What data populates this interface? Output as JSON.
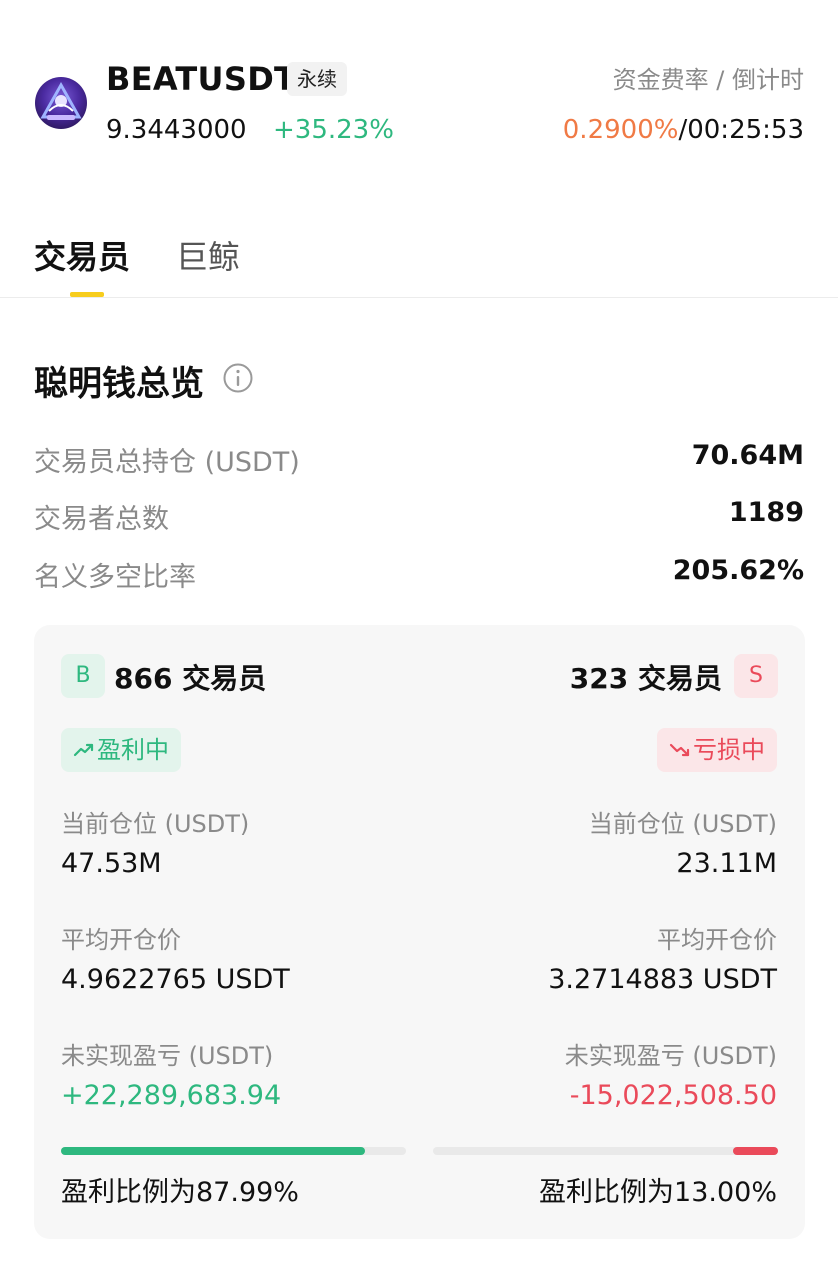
{
  "header": {
    "symbol": "BEATUSDT",
    "contract_tag": "永续",
    "price": "9.3443000",
    "change": "+35.23%",
    "funding_label": "资金费率 / 倒计时",
    "funding_rate": "0.2900%",
    "separator": "/",
    "countdown": "00:25:53"
  },
  "tabs": [
    {
      "label": "交易员",
      "active": true
    },
    {
      "label": "巨鲸",
      "active": false
    }
  ],
  "overview": {
    "title": "聪明钱总览",
    "stats": [
      {
        "label": "交易员总持仓 (USDT)",
        "value": "70.64M"
      },
      {
        "label": "交易者总数",
        "value": "1189"
      },
      {
        "label": "名义多空比率",
        "value": "205.62%"
      }
    ]
  },
  "long_side": {
    "badge": "B",
    "count_label": "866 交易员",
    "status": "盈利中",
    "position_label": "当前仓位 (USDT)",
    "position_value": "47.53M",
    "avg_price_label": "平均开仓价",
    "avg_price_value": "4.9622765 USDT",
    "upnl_label": "未实现盈亏 (USDT)",
    "upnl_value": "+22,289,683.94",
    "profit_ratio": 87.99,
    "ratio_label": "盈利比例为87.99%"
  },
  "short_side": {
    "badge": "S",
    "count_label": "323 交易员",
    "status": "亏损中",
    "position_label": "当前仓位 (USDT)",
    "position_value": "23.11M",
    "avg_price_label": "平均开仓价",
    "avg_price_value": "3.2714883 USDT",
    "upnl_label": "未实现盈亏 (USDT)",
    "upnl_value": "-15,022,508.50",
    "profit_ratio": 13.0,
    "ratio_label": "盈利比例为13.00%"
  },
  "colors": {
    "positive": "#2eb87f",
    "negative": "#ea4a5a",
    "funding": "#f07a45",
    "tab_accent": "#f7cd1d"
  },
  "icons": {
    "avatar": "token-avatar",
    "info": "info-icon",
    "profit": "trend-up-icon",
    "loss": "trend-down-icon"
  }
}
